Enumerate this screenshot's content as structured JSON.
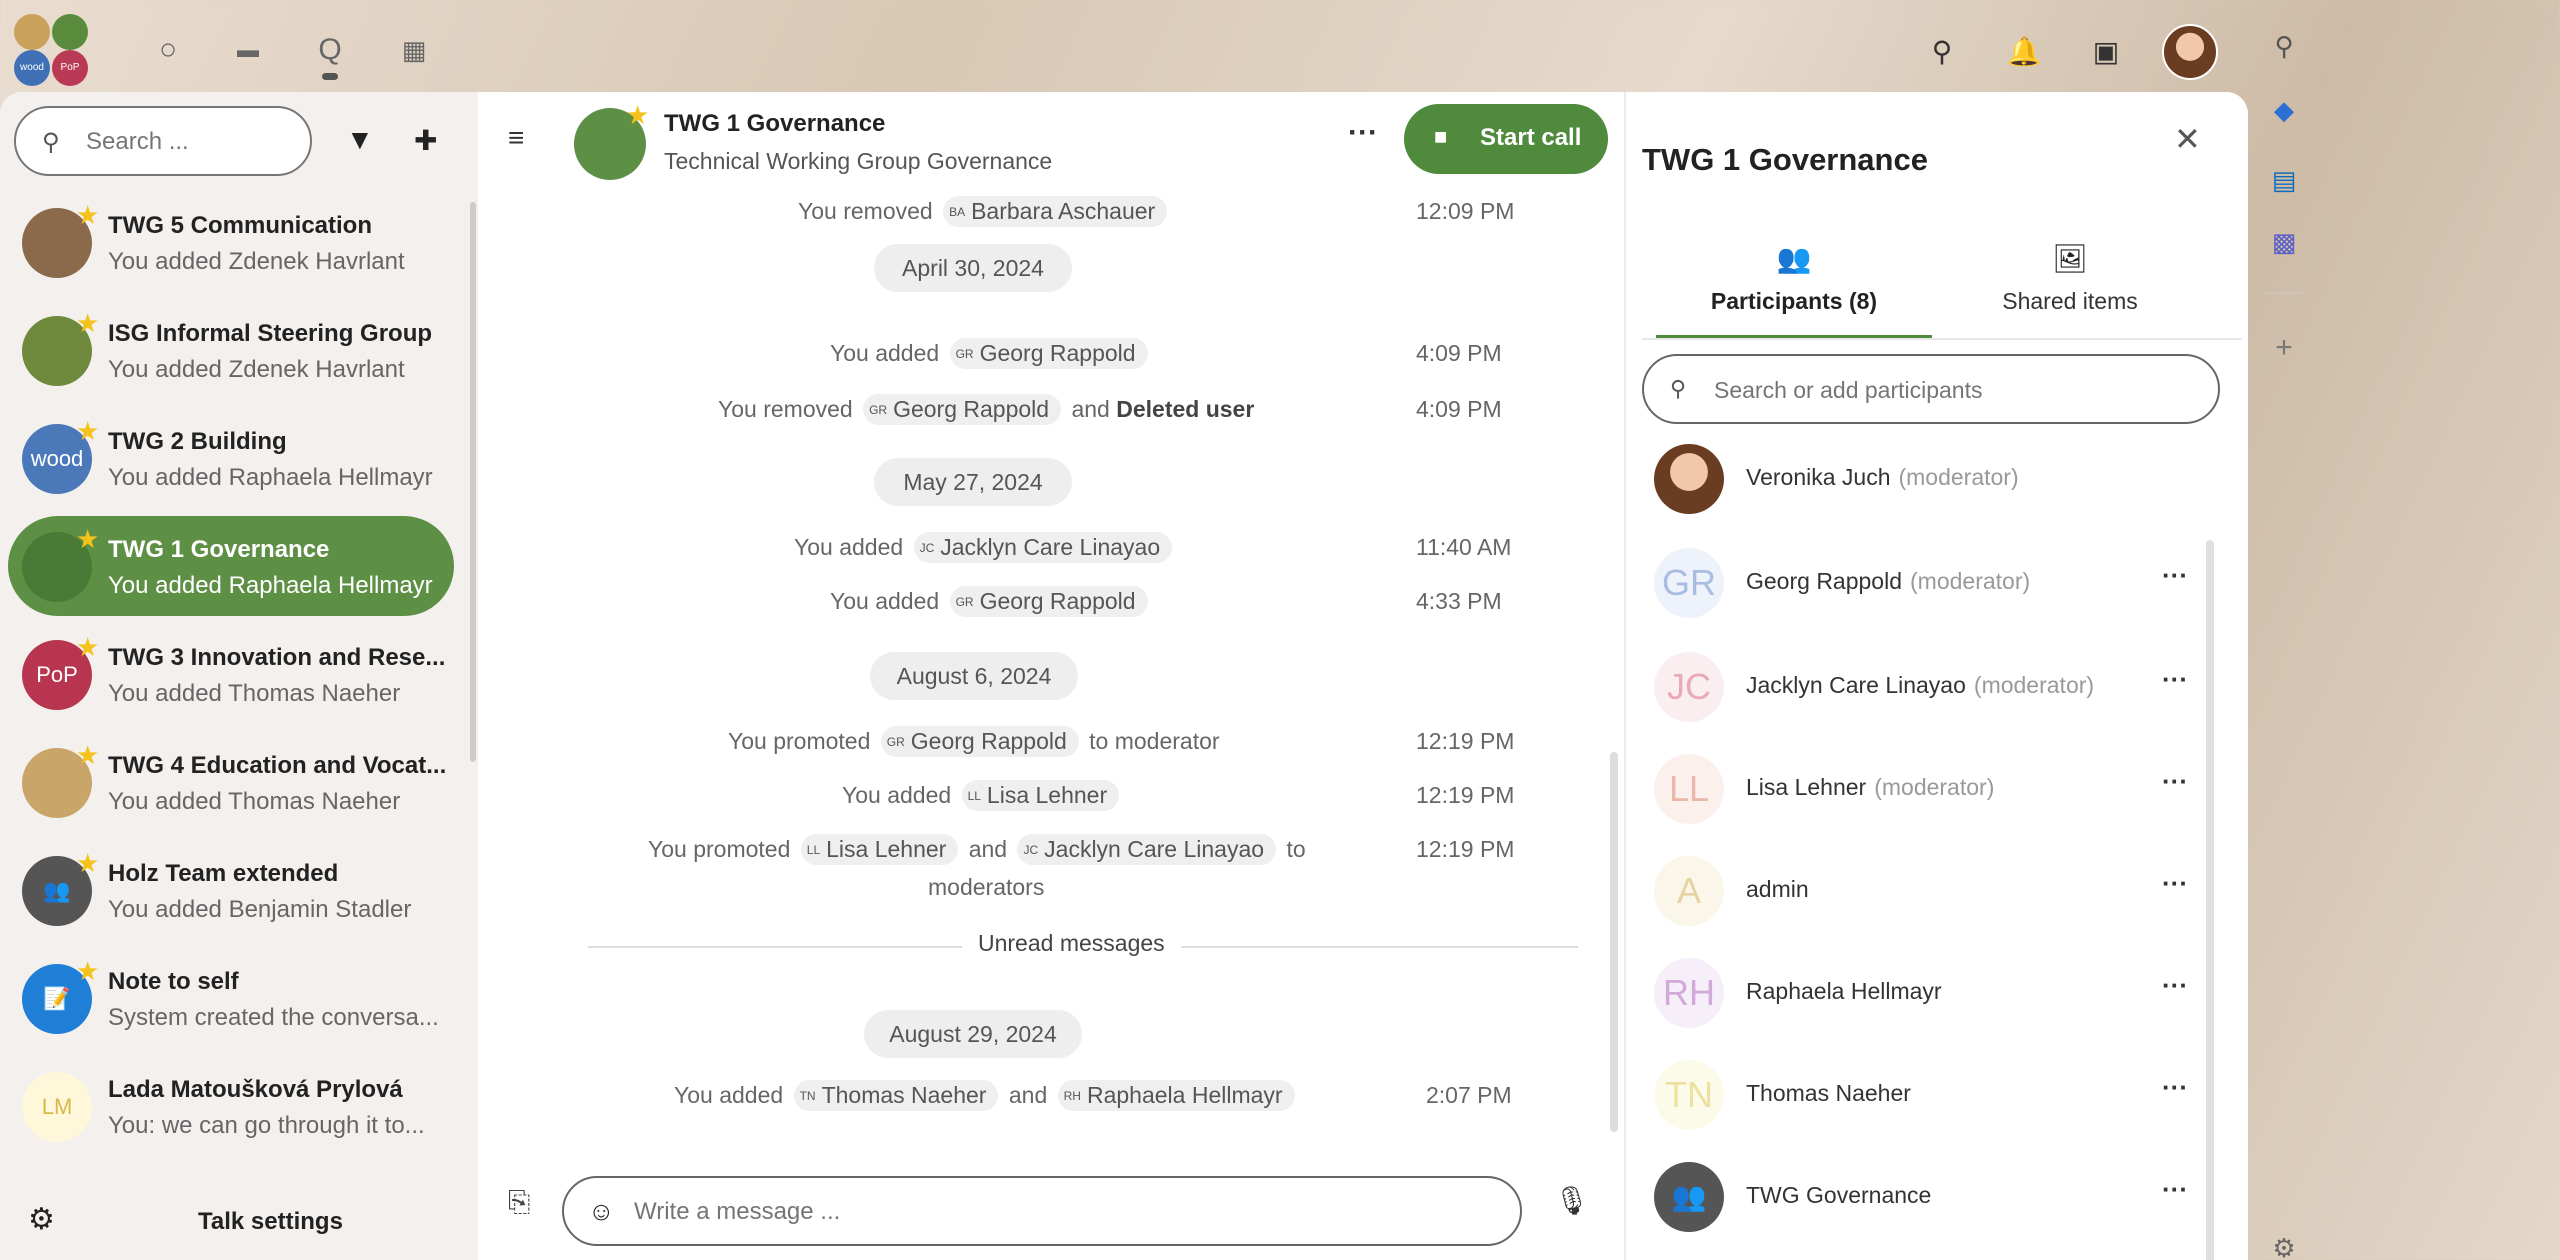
{
  "header": {
    "apps": [
      {
        "name": "dashboard",
        "icon": "○"
      },
      {
        "name": "files",
        "icon": "▬"
      },
      {
        "name": "talk",
        "icon": "Q"
      },
      {
        "name": "calendar",
        "icon": "▦"
      }
    ],
    "logo_labels": [
      "wood",
      "PoP"
    ]
  },
  "sidebar": {
    "search_placeholder": "Search ...",
    "settings_label": "Talk settings",
    "conversations": [
      {
        "name": "TWG 5 Communication",
        "sub": "You added Zdenek Havrlant",
        "color": "#8a6a4a",
        "initials": ""
      },
      {
        "name": "ISG Informal Steering Group",
        "sub": "You added Zdenek Havrlant",
        "color": "#6f8a3c",
        "initials": ""
      },
      {
        "name": "TWG 2 Building",
        "sub": "You added Raphaela Hellmayr",
        "color": "#4a78b8",
        "initials": "wood"
      },
      {
        "name": "TWG 1 Governance",
        "sub": "You added Raphaela Hellmayr",
        "color": "#4b7a36",
        "initials": ""
      },
      {
        "name": "TWG 3 Innovation and Rese...",
        "sub": "You added Thomas Naeher",
        "color": "#b8354f",
        "initials": "PoP"
      },
      {
        "name": "TWG 4 Education and Vocat...",
        "sub": "You added Thomas Naeher",
        "color": "#caa56a",
        "initials": ""
      },
      {
        "name": "Holz Team extended",
        "sub": "You added Benjamin Stadler",
        "color": "#555555",
        "initials": "👥"
      },
      {
        "name": "Note to self",
        "sub": "System created the conversa...",
        "color": "#1f7ed6",
        "initials": "📝"
      },
      {
        "name": "Lada Matoušková Prylová",
        "sub": "You: we can go through it to...",
        "color": "#fff7d9",
        "initials": "LM"
      }
    ]
  },
  "chat": {
    "title": "TWG 1 Governance",
    "description": "Technical Working Group Governance",
    "start_call_label": "Start call",
    "composer_placeholder": "Write a message ...",
    "unread_label": "Unread messages",
    "dates": [
      "April 30, 2024",
      "May 27, 2024",
      "August 6, 2024",
      "August 29, 2024"
    ],
    "messages": {
      "m1": {
        "pre": "You removed",
        "p1": "Barbara Aschauer",
        "i1": "BA",
        "time": "12:09 PM"
      },
      "m2": {
        "pre": "You added",
        "p1": "Georg Rappold",
        "i1": "GR",
        "time": "4:09 PM"
      },
      "m3": {
        "pre": "You removed",
        "p1": "Georg Rappold",
        "i1": "GR",
        "mid": "and",
        "bold": "Deleted user",
        "time": "4:09 PM"
      },
      "m4": {
        "pre": "You added",
        "p1": "Jacklyn Care Linayao",
        "i1": "JC",
        "time": "11:40 AM"
      },
      "m5": {
        "pre": "You added",
        "p1": "Georg Rappold",
        "i1": "GR",
        "time": "4:33 PM"
      },
      "m6": {
        "pre": "You promoted",
        "p1": "Georg Rappold",
        "i1": "GR",
        "post": "to moderator",
        "time": "12:19 PM"
      },
      "m7": {
        "pre": "You added",
        "p1": "Lisa Lehner",
        "i1": "LL",
        "time": "12:19 PM"
      },
      "m8": {
        "pre": "You promoted",
        "p1": "Lisa Lehner",
        "i1": "LL",
        "mid": "and",
        "p2": "Jacklyn Care Linayao",
        "i2": "JC",
        "post": "to",
        "line2": "moderators",
        "time": "12:19 PM"
      },
      "m9": {
        "pre": "You added",
        "p1": "Thomas Naeher",
        "i1": "TN",
        "mid": "and",
        "p2": "Raphaela Hellmayr",
        "i2": "RH",
        "time": "2:07 PM"
      }
    }
  },
  "panel": {
    "title": "TWG 1 Governance",
    "tab_participants": "Participants (8)",
    "tab_shared": "Shared items",
    "search_placeholder": "Search or add participants",
    "participants": [
      {
        "name": "Veronika Juch",
        "role": "(moderator)",
        "initials": "",
        "color": "#f3e4d8",
        "text": "#333"
      },
      {
        "name": "Georg Rappold",
        "role": "(moderator)",
        "initials": "GR",
        "color": "#eef2fa",
        "text": "#a9bde3"
      },
      {
        "name": "Jacklyn Care Linayao",
        "role": "(moderator)",
        "initials": "JC",
        "color": "#fbeef1",
        "text": "#e8a9b8"
      },
      {
        "name": "Lisa Lehner",
        "role": "(moderator)",
        "initials": "LL",
        "color": "#fcf0ed",
        "text": "#ecb6a8"
      },
      {
        "name": "admin",
        "role": "",
        "initials": "A",
        "color": "#fbf6ea",
        "text": "#e6d3a4"
      },
      {
        "name": "Raphaela Hellmayr",
        "role": "",
        "initials": "RH",
        "color": "#f6eef8",
        "text": "#d1aad9"
      },
      {
        "name": "Thomas Naeher",
        "role": "",
        "initials": "TN",
        "color": "#fcfbe9",
        "text": "#ebe2a0"
      },
      {
        "name": "TWG Governance",
        "role": "",
        "initials": "👥",
        "color": "#555555",
        "text": "#ffffff"
      }
    ]
  },
  "colors": {
    "accent": "#4f8a3d",
    "active_item": "#5d8f45",
    "star": "#f4c21b"
  }
}
